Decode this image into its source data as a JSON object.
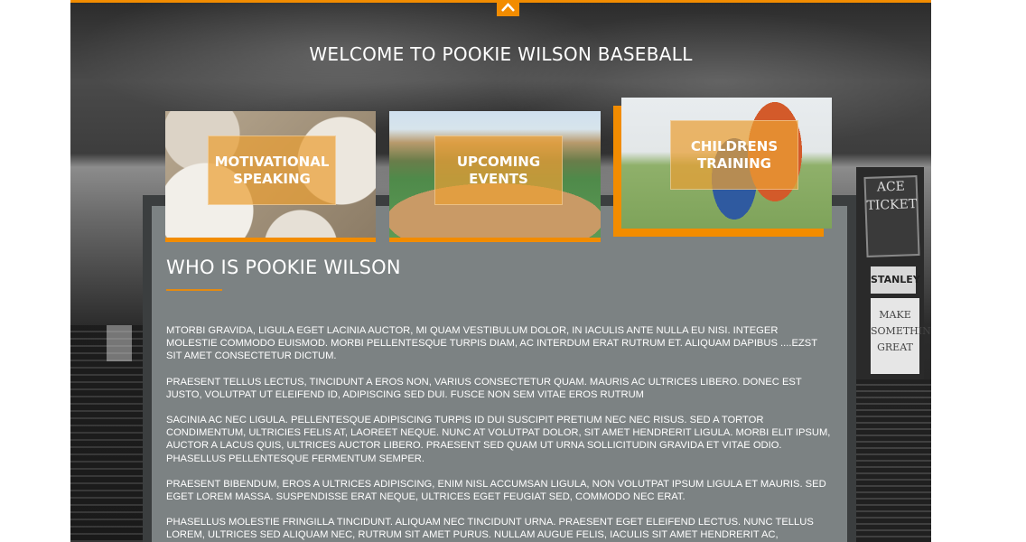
{
  "page": {
    "welcome_title": "WELCOME TO POOKIE WILSON BASEBALL",
    "scroll_top_icon": "chevron-up-icon"
  },
  "colors": {
    "accent": "#f28c00",
    "panel": "#7c8283",
    "panel_shadow": "#3b3e3f",
    "text": "#ffffff"
  },
  "cards": [
    {
      "label_line1": "MOTIVATIONAL",
      "label_line2": "SPEAKING",
      "image": "baseballs-photo"
    },
    {
      "label_line1": "UPCOMING",
      "label_line2": "EVENTS",
      "image": "ballpark-photo"
    },
    {
      "label_line1": "CHILDRENS",
      "label_line2": "TRAINING",
      "image": "kids-baseball-photo"
    }
  ],
  "background_signs": {
    "ace": "ACE TICKET",
    "stanley": "STANLEY",
    "make_line1": "MAKE",
    "make_line2": "SOMETHING",
    "make_line3": "GREAT"
  },
  "about": {
    "heading": "WHO IS POOKIE WILSON",
    "paragraphs": [
      "MTORBI GRAVIDA, LIGULA EGET LACINIA AUCTOR, MI QUAM VESTIBULUM DOLOR, IN IACULIS ANTE NULLA EU NISI. INTEGER MOLESTIE COMMODO EUISMOD. MORBI PELLENTESQUE TURPIS DIAM, AC INTERDUM ERAT RUTRUM ET. ALIQUAM DAPIBUS ....EZST SIT AMET CONSECTETUR DICTUM.",
      "PRAESENT TELLUS LECTUS, TINCIDUNT A EROS NON, VARIUS CONSECTETUR QUAM. MAURIS AC ULTRICES LIBERO. DONEC EST JUSTO, VOLUTPAT UT ELEIFEND ID, ADIPISCING SED DUI. FUSCE NON SEM VITAE EROS RUTRUM",
      "SACINIA AC NEC LIGULA. PELLENTESQUE ADIPISCING TURPIS ID DUI SUSCIPIT PRETIUM NEC NEC RISUS. SED A TORTOR CONDIMENTUM, ULTRICIES FELIS AT, LAOREET NEQUE. NUNC AT VOLUTPAT DOLOR, SIT AMET HENDRERIT LIGULA. MORBI ELIT IPSUM, AUCTOR A LACUS QUIS, ULTRICES AUCTOR LIBERO. PRAESENT SED QUAM UT URNA SOLLICITUDIN GRAVIDA ET VITAE ODIO. PHASELLUS PELLENTESQUE FERMENTUM SEMPER.",
      "PRAESENT BIBENDUM, EROS A ULTRICES ADIPISCING, ENIM NISL ACCUMSAN LIGULA, NON VOLUTPAT IPSUM LIGULA ET MAURIS. SED EGET LOREM MASSA. SUSPENDISSE ERAT NEQUE, ULTRICES EGET FEUGIAT SED, COMMODO NEC ERAT.",
      "PHASELLUS MOLESTIE FRINGILLA TINCIDUNT. ALIQUAM NEC TINCIDUNT URNA. PRAESENT EGET ELEIFEND LECTUS. NUNC TELLUS LOREM, ULTRICES SED ALIQUAM NEC, RUTRUM SIT AMET PURUS. NULLAM AUGUE FELIS, IACULIS SIT AMET HENDRERIT AC, CONSECTETUR NON"
    ]
  }
}
